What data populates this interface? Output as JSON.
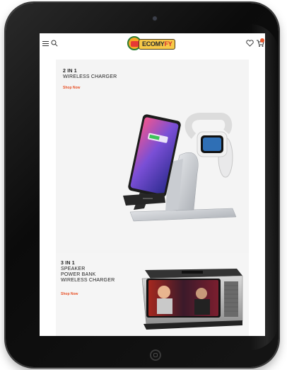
{
  "header": {
    "logo_prefix": "ECOMY",
    "logo_suffix": "FY",
    "menu_icon": "hamburger-menu-icon",
    "search_icon": "search-icon",
    "wishlist_icon": "heart-icon",
    "cart_icon": "cart-icon"
  },
  "banners": [
    {
      "title_strong": "2 IN 1",
      "title_lines": [
        "WIRELESS CHARGER"
      ],
      "cta": "Shop Now"
    },
    {
      "title_strong": "3 IN 1",
      "title_lines": [
        "SPEAKER",
        "POWER BANK",
        "WIRELESS CHARGER"
      ],
      "cta": "Shop Now"
    }
  ],
  "colors": {
    "accent": "#e8542a",
    "logo_yellow": "#f7c948",
    "logo_red": "#d32f2f"
  }
}
